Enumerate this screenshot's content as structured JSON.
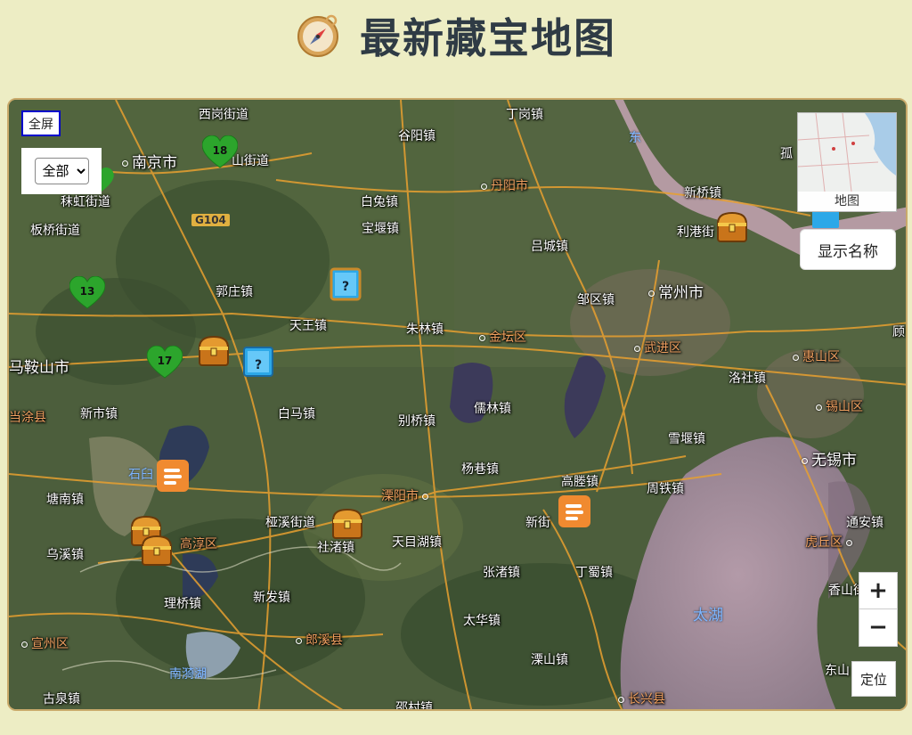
{
  "header": {
    "title": "最新藏宝地图",
    "icon": "compass-icon"
  },
  "controls": {
    "fullscreen_label": "全屏",
    "filter_options": [
      "全部"
    ],
    "filter_selected": "全部",
    "minimap_label": "地图",
    "show_names_label": "显示名称",
    "zoom_in_label": "+",
    "zoom_out_label": "−",
    "locate_label": "定位"
  },
  "places": {
    "p1": "南京市",
    "p2": "西岗街道",
    "p3": "山街道",
    "p4": "谷阳镇",
    "p5": "丁岗镇",
    "p6": "丹阳市",
    "p7": "新桥镇",
    "p8": "利港街",
    "p9": "白兔镇",
    "p10": "宝堰镇",
    "p11": "吕城镇",
    "p12": "郭庄镇",
    "p13": "邹区镇",
    "p14": "常州市",
    "p15": "天王镇",
    "p16": "朱林镇",
    "p17": "金坛区",
    "p18": "武进区",
    "p19": "马鞍山市",
    "p20": "新市镇",
    "p21": "白马镇",
    "p22": "别桥镇",
    "p23": "儒林镇",
    "p24": "洛社镇",
    "p25": "惠山区",
    "p26": "锡山区",
    "p27": "雪堰镇",
    "p28": "无锡市",
    "p29": "塘南镇",
    "p30": "杨巷镇",
    "p31": "高塍镇",
    "p32": "周铁镇",
    "p33": "溧阳市",
    "p34": "新街",
    "p35": "桠溪街道",
    "p36": "社渚镇",
    "p37": "高淳区",
    "p38": "乌溪镇",
    "p39": "天目湖镇",
    "p40": "张渚镇",
    "p41": "丁蜀镇",
    "p42": "新发镇",
    "p43": "通安镇",
    "p44": "虎丘区",
    "p45": "香山街",
    "p46": "理桥镇",
    "p47": "太湖",
    "p48": "郎溪县",
    "p49": "太华镇",
    "p50": "溧山镇",
    "p51": "宣州区",
    "p52": "南漪湖",
    "p53": "东山",
    "p54": "古泉镇",
    "p55": "邵村镇",
    "p56": "长兴县",
    "p57": "板桥街道",
    "p58": "孤",
    "p59": "顾",
    "p60": "当涂县",
    "p61": "石臼",
    "p62": "G104",
    "p63": "秣虹街道",
    "p64": "东"
  },
  "markers": {
    "heart_18": "18",
    "heart_13": "13",
    "heart_17": "17"
  },
  "colors": {
    "page_bg": "#ededc4",
    "title": "#2f3b45",
    "frame_border": "#c9aa6b",
    "heart": "#2ca52c",
    "chest": "#d98a1a",
    "orange_marker": "#f08a30",
    "ice": "#2ca8e8"
  }
}
